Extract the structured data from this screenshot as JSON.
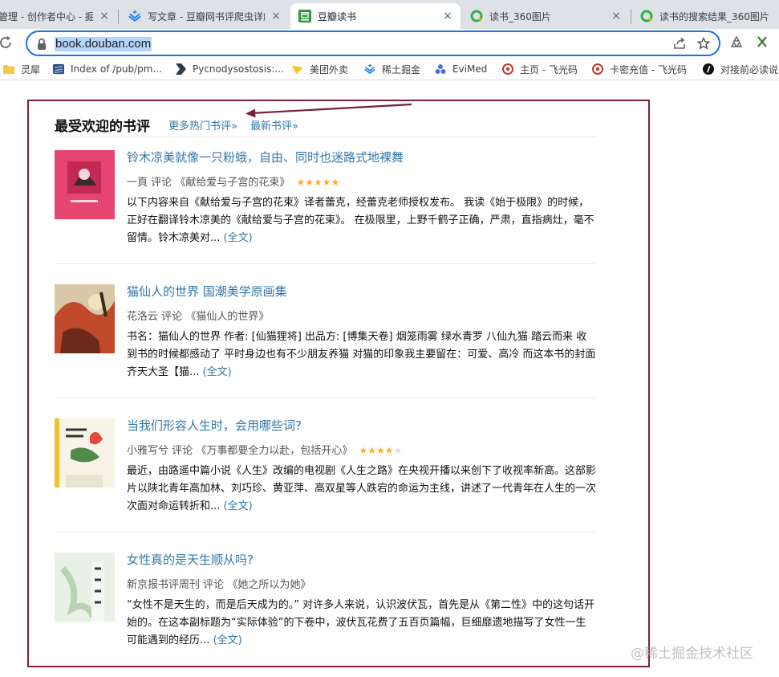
{
  "browser": {
    "tabs": [
      {
        "title": "管理 - 创作者中心 - 掘金",
        "favicon": "juejin-icon",
        "active": false
      },
      {
        "title": "写文章 - 豆瓣网书评爬虫详解",
        "favicon": "juejin-icon",
        "active": false
      },
      {
        "title": "豆瓣读书",
        "favicon": "douban-icon",
        "active": true
      },
      {
        "title": "读书_360图片",
        "favicon": "360-icon",
        "active": false
      },
      {
        "title": "读书的搜索结果_360图片",
        "favicon": "360-icon",
        "active": false
      }
    ],
    "close_glyph": "×",
    "url": "book.douban.com",
    "bookmarks": [
      {
        "label": "灵犀",
        "icon": "folder-icon"
      },
      {
        "label": "Index of /pub/pm...",
        "icon": "ftp-icon"
      },
      {
        "label": "Pycnodysostosis:...",
        "icon": "arrow-bookmark-icon"
      },
      {
        "label": "美团外卖",
        "icon": "meituan-icon"
      },
      {
        "label": "稀土掘金",
        "icon": "juejin-icon"
      },
      {
        "label": "EviMed",
        "icon": "evimed-icon"
      },
      {
        "label": "主页 - 飞光码",
        "icon": "target-icon"
      },
      {
        "label": "卡密充值 - 飞光码",
        "icon": "target-icon"
      },
      {
        "label": "对接前必读说",
        "icon": "info-icon"
      }
    ]
  },
  "page": {
    "section_title": "最受欢迎的书评",
    "more_reviews_link": "更多热门书评»",
    "latest_reviews_link": "最新书评»",
    "reviews": [
      {
        "title": "铃木凉美就像一只粉蛾，自由、同时也迷路式地裸舞",
        "author": "一頁",
        "kind": "评论",
        "book": "《献给爱与子宫的花束》",
        "rating": 5,
        "excerpt": "以下内容来自《献给爱与子宫的花束》译者蕾克，经蕾克老师授权发布。 我读《始于极限》的时候，正好在翻译铃木凉美的《献给爱与子宫的花束》。 在极限里，上野千鹤子正确，严肃，直指病灶，毫不留情。铃木凉美对...",
        "full_link": "(全文)"
      },
      {
        "title": "猫仙人的世界 国潮美学原画集",
        "author": "花洛云",
        "kind": "评论",
        "book": "《猫仙人的世界》",
        "rating": 0,
        "excerpt": "书名：猫仙人的世界 作者: [仙猫狸将] 出品方: [博集天卷] 烟笼雨雾 绿水青罗 八仙九猫 踏云而来 收到书的时候都感动了 平时身边也有不少朋友养猫 对猫的印象我主要留在：可爱、高冷 而这本书的封面齐天大圣【猫...",
        "full_link": "(全文)"
      },
      {
        "title": "当我们形容人生时，会用哪些词?",
        "author": "小雅写兮",
        "kind": "评论",
        "book": "《万事都要全力以赴，包括开心》",
        "rating": 4,
        "excerpt": "最近，由路遥中篇小说《人生》改编的电视剧《人生之路》在央视开播以来创下了收视率新高。这部影片以陕北青年高加林、刘巧珍、黄亚萍、高双星等人跌宕的命运为主线，讲述了一代青年在人生的一次次面对命运转折和...",
        "full_link": "(全文)"
      },
      {
        "title": "女性真的是天生顺从吗?",
        "author": "新京报书评周刊",
        "kind": "评论",
        "book": "《她之所以为她》",
        "rating": 0,
        "excerpt": "“女性不是天生的，而是后天成为的。” 对许多人来说，认识波伏瓦，首先是从《第二性》中的这句话开始的。在这本副标题为“实际体验”的下卷中，波伏瓦花费了五百页篇幅，巨细靡遗地描写了女性一生可能遇到的经历...",
        "full_link": "(全文)"
      }
    ]
  },
  "watermark": "@稀土掘金技术社区",
  "colors": {
    "link": "#3377aa",
    "frame": "#7a1f3d",
    "star": "#ffac2d",
    "url_highlight": "#b3d4fc",
    "omnibox_border": "#1a73e8"
  }
}
